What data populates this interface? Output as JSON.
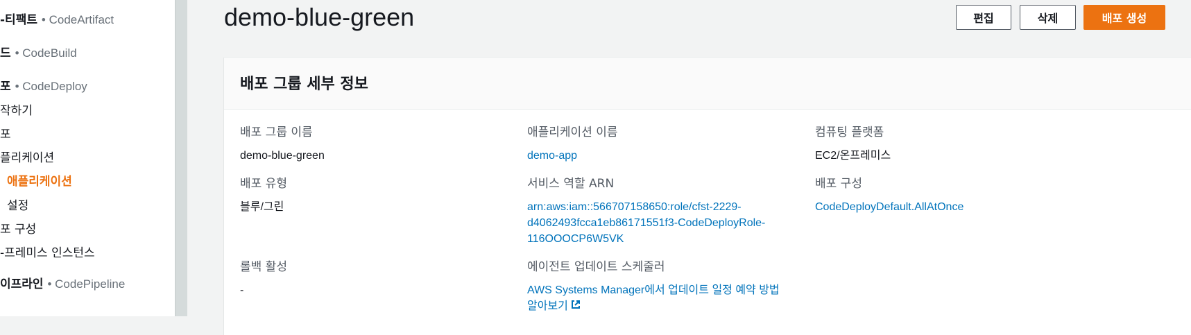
{
  "sidebar": {
    "items": [
      {
        "label": "-티팩트",
        "service": "• CodeArtifact",
        "kind": "section"
      },
      {
        "label": "드",
        "service": "• CodeBuild",
        "kind": "section"
      },
      {
        "label": "포",
        "service": "• CodeDeploy",
        "kind": "section"
      },
      {
        "label": "작하기",
        "kind": "item"
      },
      {
        "label": "포",
        "kind": "item"
      },
      {
        "label": "플리케이션",
        "kind": "item"
      },
      {
        "label": "애플리케이션",
        "kind": "active"
      },
      {
        "label": "설정",
        "kind": "sub"
      },
      {
        "label": "포 구성",
        "kind": "item"
      },
      {
        "label": "-프레미스 인스턴스",
        "kind": "item"
      },
      {
        "label": "이프라인",
        "service": "• CodePipeline",
        "kind": "section"
      }
    ]
  },
  "header": {
    "title": "demo-blue-green",
    "edit_label": "편집",
    "delete_label": "삭제",
    "create_label": "배포 생성"
  },
  "panel": {
    "title": "배포 그룹 세부 정보",
    "fields": {
      "group_name": {
        "label": "배포 그룹 이름",
        "value": "demo-blue-green"
      },
      "app_name": {
        "label": "애플리케이션 이름",
        "value": "demo-app"
      },
      "platform": {
        "label": "컴퓨팅 플랫폼",
        "value": "EC2/온프레미스"
      },
      "deploy_type": {
        "label": "배포 유형",
        "value": "블루/그린"
      },
      "role_arn": {
        "label": "서비스 역할 ARN",
        "value_lines": [
          "arn:aws:iam::566707158650:role/cfst-2229-",
          "d4062493fcca1eb86171551f3-CodeDeployRole-",
          "116OOOCP6W5VK"
        ]
      },
      "deploy_config": {
        "label": "배포 구성",
        "value": "CodeDeployDefault.AllAtOnce"
      },
      "rollback": {
        "label": "롤백 활성",
        "value": "-"
      },
      "agent_scheduler": {
        "label": "에이전트 업데이트 스케줄러",
        "value_lines": [
          "AWS Systems Manager에서 업데이트 일정 예약 방법",
          "알아보기"
        ]
      }
    }
  },
  "colors": {
    "accent": "#ec7211",
    "link": "#0073bb"
  }
}
